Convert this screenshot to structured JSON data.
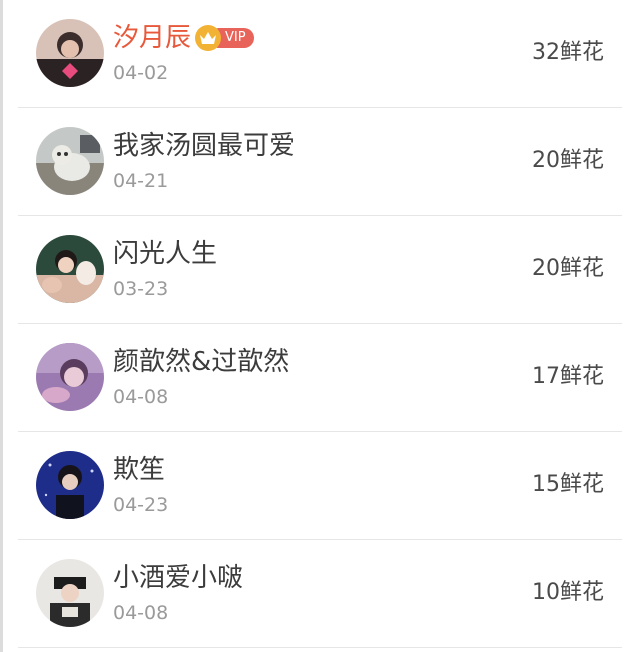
{
  "vip": {
    "badge_text": "VIP",
    "crown_icon": "crown-icon",
    "name_color": "#e8593b"
  },
  "rows": [
    {
      "name": "汐月辰",
      "date": "04-02",
      "flowers": "32鲜花",
      "is_vip": true
    },
    {
      "name": "我家汤圆最可爱",
      "date": "04-21",
      "flowers": "20鲜花",
      "is_vip": false
    },
    {
      "name": "闪光人生",
      "date": "03-23",
      "flowers": "20鲜花",
      "is_vip": false
    },
    {
      "name": "颜歆然&过歆然",
      "date": "04-08",
      "flowers": "17鲜花",
      "is_vip": false
    },
    {
      "name": "欺笙",
      "date": "04-23",
      "flowers": "15鲜花",
      "is_vip": false
    },
    {
      "name": "小酒爱小啵",
      "date": "04-08",
      "flowers": "10鲜花",
      "is_vip": false
    }
  ]
}
